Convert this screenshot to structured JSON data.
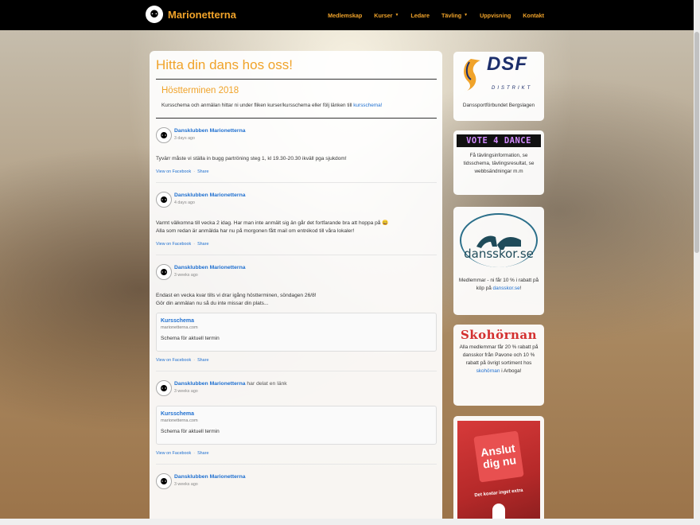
{
  "navbar": {
    "brand": "Marionetterna",
    "items": [
      {
        "label": "Medlemskap",
        "dropdown": false
      },
      {
        "label": "Kurser",
        "dropdown": true
      },
      {
        "label": "Ledare",
        "dropdown": false
      },
      {
        "label": "Tävling",
        "dropdown": true
      },
      {
        "label": "Uppvisning",
        "dropdown": false
      },
      {
        "label": "Kontakt",
        "dropdown": false
      }
    ]
  },
  "main": {
    "title": "Hitta din dans hos oss!",
    "section_title": "Höstterminen 2018",
    "section_text": "Kursschema och anmälan hittar ni under fliken kurser/kursschema eller följ länken till ",
    "section_link": "kursschema!"
  },
  "posts": [
    {
      "author": "Dansklubben Marionetterna",
      "extra": "",
      "time": "3 days ago",
      "lines": [
        "Tyvärr måste vi ställa in bugg partröning steg 1, kl 19.30-20.30 ikväll pga sjukdom!"
      ],
      "card": null
    },
    {
      "author": "Dansklubben Marionetterna",
      "extra": "",
      "time": "4 days ago",
      "lines": [
        "Varmt välkomna till vecka 2 idag. Har man inte anmält sig än går det fortfarande bra att hoppa på 😀",
        "Alla som redan är anmälda har nu på morgonen fått mail om entrékod till våra lokaler!"
      ],
      "card": null
    },
    {
      "author": "Dansklubben Marionetterna",
      "extra": "",
      "time": "3 weeks ago",
      "lines": [
        "Endast en vecka kvar tills vi drar igång höstterminen, söndagen 26/8!",
        "Gör din anmälan nu så du inte missar din plats..."
      ],
      "card": {
        "title": "Kursschema",
        "domain": "marionetterna.com",
        "desc": "Schema för aktuell termin"
      }
    },
    {
      "author": "Dansklubben Marionetterna",
      "extra": " har delat en länk",
      "time": "3 weeks ago",
      "lines": [],
      "card": {
        "title": "Kursschema",
        "domain": "marionetterna.com",
        "desc": "Schema för aktuell termin"
      }
    },
    {
      "author": "Dansklubben Marionetterna",
      "extra": "",
      "time": "3 weeks ago",
      "lines": [],
      "card": null
    }
  ],
  "post_actions": {
    "facebook": "View on Facebook",
    "share": "Share",
    "sep": "·"
  },
  "sidebar": {
    "dsf": {
      "logo_text": "DSF",
      "logo_sub": "DISTRIKT",
      "caption": "Danssportförbundet Bergslagen"
    },
    "vote": {
      "logo_text": "VOTE 4 DANCE",
      "caption": "Få tävlingsinformation, se tidsschema, tävlingsresultat, se webbsändningar m.m"
    },
    "dansskor": {
      "logo_text": "dansskor.se",
      "caption_pre": "Medlemmar - ni får 10 % i rabatt på köp på ",
      "caption_link": "dansskor.se",
      "caption_post": "!"
    },
    "skohornan": {
      "logo_text": "Skohörnan",
      "caption_pre": "Alla medlemmar får 20 % rabatt på dansskor från Pavone och 10 % rabatt på övrigt sortiment hos ",
      "caption_link": "skohörnan",
      "caption_post": " i Arboga!"
    },
    "anslut": {
      "badge": "Anslut dig nu",
      "strip": "Det kostar inget extra"
    }
  },
  "colors": {
    "accent": "#f0a32a",
    "link": "#1e6fd0",
    "navbar": "#000000"
  }
}
